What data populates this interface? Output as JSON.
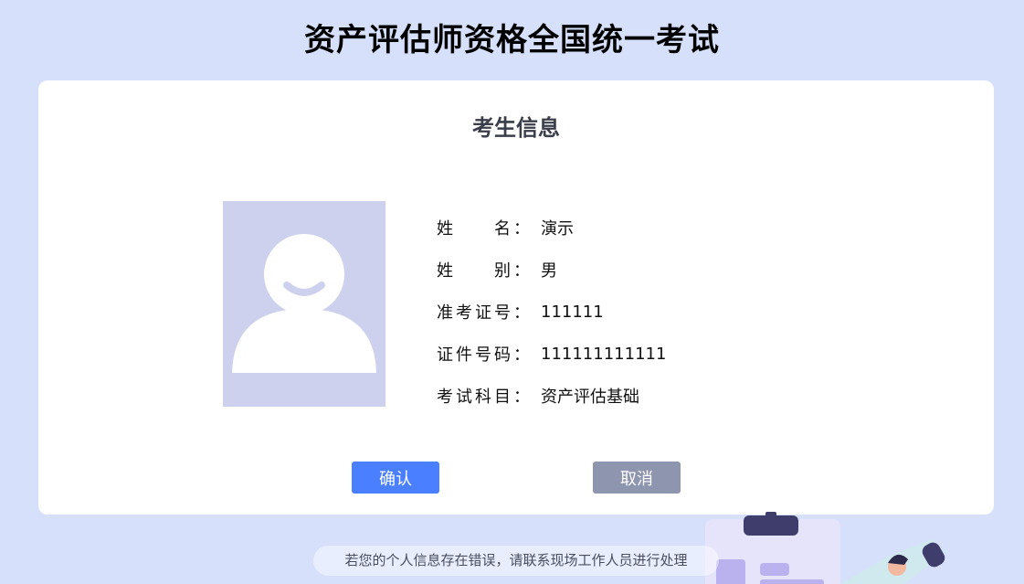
{
  "header": {
    "title": "资产评估师资格全国统一考试"
  },
  "card": {
    "title": "考生信息",
    "fields": [
      {
        "label": "姓　　名：",
        "value": "演示"
      },
      {
        "label": "姓　　别：",
        "value": "男"
      },
      {
        "label": "准考证号：",
        "value": "111111"
      },
      {
        "label": "证件号码：",
        "value": "111111111111"
      },
      {
        "label": "考试科目：",
        "value": "资产评估基础"
      }
    ],
    "photo_icon": "avatar-placeholder-icon"
  },
  "actions": {
    "confirm_label": "确认",
    "cancel_label": "取消"
  },
  "notice": {
    "text": "若您的个人信息存在错误，请联系现场工作人员进行处理"
  },
  "colors": {
    "background": "#d6e0fb",
    "confirm": "#4a7fff",
    "cancel": "#8e95ae",
    "photo_bg": "#cdd1ee"
  }
}
